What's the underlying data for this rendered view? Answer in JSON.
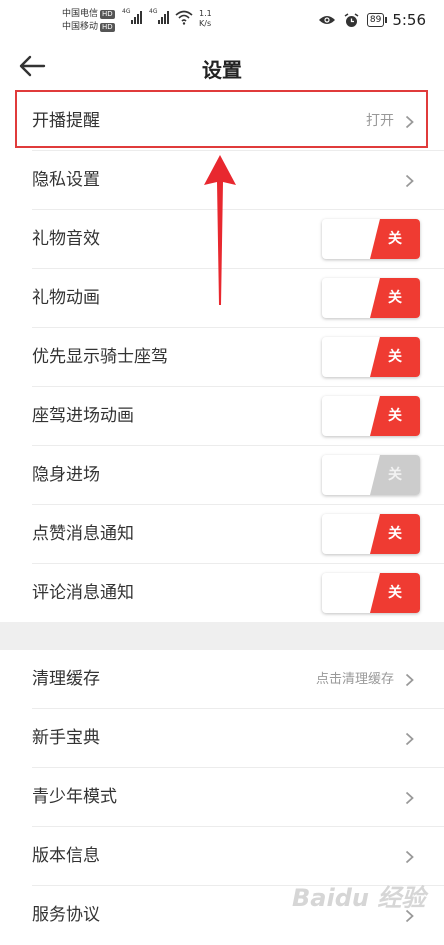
{
  "status_bar": {
    "carrier_top": "中国电信",
    "carrier_bottom": "中国移动",
    "hd": "HD",
    "network_1": "4G",
    "network_2": "4G",
    "speed_value": "1.1",
    "speed_unit": "K/s",
    "battery": "89",
    "time": "5:56"
  },
  "header": {
    "title": "设置"
  },
  "settings": [
    {
      "label": "开播提醒",
      "kind": "link",
      "value": "打开"
    },
    {
      "label": "隐私设置",
      "kind": "link",
      "value": ""
    },
    {
      "label": "礼物音效",
      "kind": "toggle",
      "value": "关"
    },
    {
      "label": "礼物动画",
      "kind": "toggle",
      "value": "关"
    },
    {
      "label": "优先显示骑士座驾",
      "kind": "toggle",
      "value": "关"
    },
    {
      "label": "座驾进场动画",
      "kind": "toggle",
      "value": "关"
    },
    {
      "label": "隐身进场",
      "kind": "toggle",
      "value": "关"
    },
    {
      "label": "点赞消息通知",
      "kind": "toggle",
      "value": "关"
    },
    {
      "label": "评论消息通知",
      "kind": "toggle",
      "value": "关"
    }
  ],
  "other": [
    {
      "label": "清理缓存",
      "value": "点击清理缓存"
    },
    {
      "label": "新手宝典",
      "value": ""
    },
    {
      "label": "青少年模式",
      "value": ""
    },
    {
      "label": "版本信息",
      "value": ""
    },
    {
      "label": "服务协议",
      "value": ""
    }
  ],
  "watermark": "Baidu 经验",
  "colors": {
    "accent": "#ef3b32",
    "highlight_border": "#e03b3b",
    "disabled_toggle": "#cccccc",
    "section_gap": "#efefef"
  }
}
